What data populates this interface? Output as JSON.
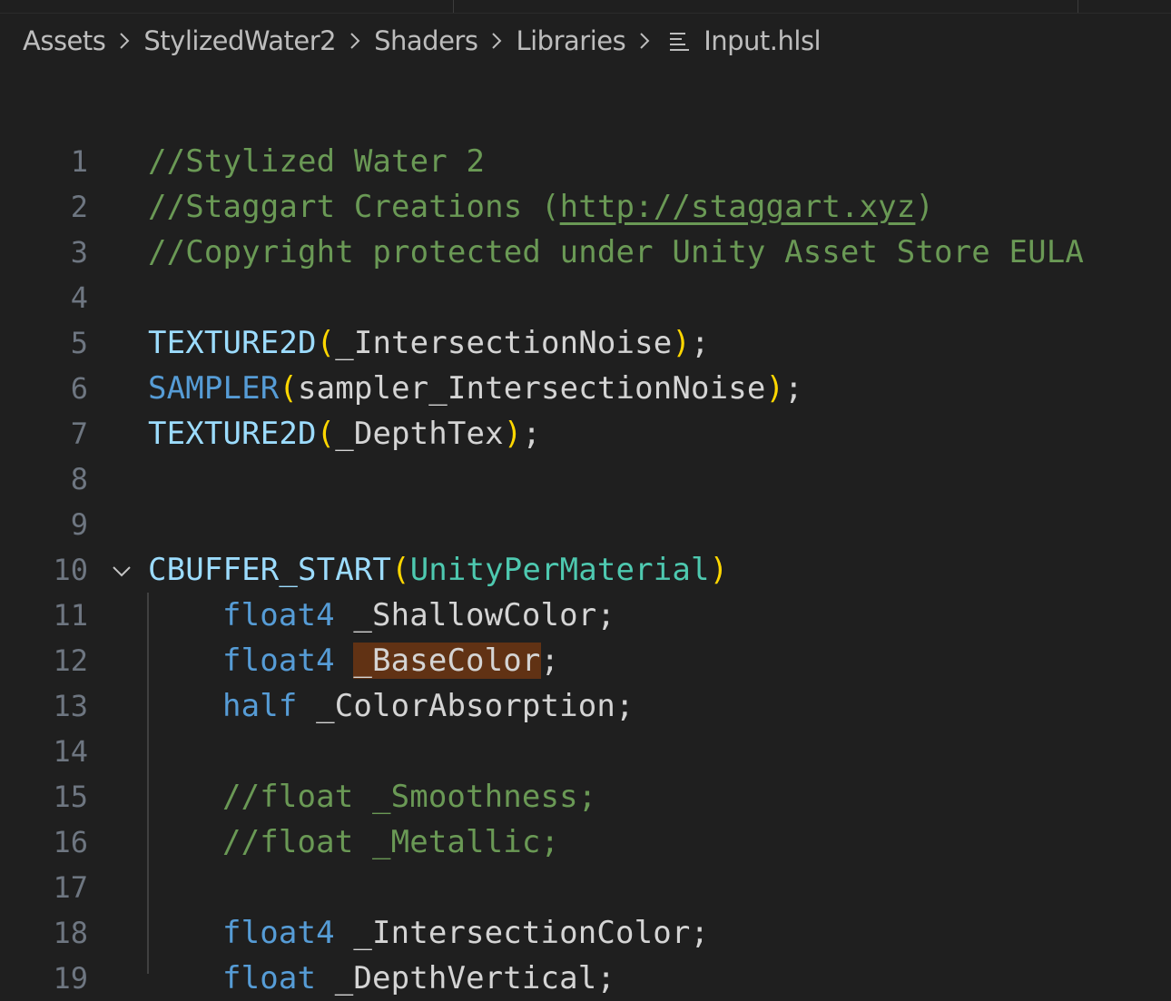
{
  "breadcrumb": {
    "items": [
      "Assets",
      "StylizedWater2",
      "Shaders",
      "Libraries"
    ],
    "file": "Input.hlsl"
  },
  "line_numbers": [
    "1",
    "2",
    "3",
    "4",
    "5",
    "6",
    "7",
    "8",
    "9",
    "10",
    "11",
    "12",
    "13",
    "14",
    "15",
    "16",
    "17",
    "18",
    "19"
  ],
  "code": {
    "l1": "//Stylized Water 2",
    "l2_a": "//Staggart Creations (",
    "l2_link": "http://staggart.xyz",
    "l2_b": ")",
    "l3": "//Copyright protected under Unity Asset Store EULA",
    "l5_macro": "TEXTURE2D",
    "l5_open": "(",
    "l5_arg": "_IntersectionNoise",
    "l5_close": ")",
    "l5_end": ";",
    "l6_macro": "SAMPLER",
    "l6_open": "(",
    "l6_arg": "sampler_IntersectionNoise",
    "l6_close": ")",
    "l6_end": ";",
    "l7_macro": "TEXTURE2D",
    "l7_open": "(",
    "l7_arg": "_DepthTex",
    "l7_close": ")",
    "l7_end": ";",
    "l10_macro": "CBUFFER_START",
    "l10_open": "(",
    "l10_arg": "UnityPerMaterial",
    "l10_close": ")",
    "l11_type": "float4",
    "l11_name": " _ShallowColor;",
    "l12_type": "float4",
    "l12_sp": " ",
    "l12_name": "_BaseColor",
    "l12_end": ";",
    "l13_type": "half",
    "l13_name": " _ColorAbsorption;",
    "l15": "//float _Smoothness;",
    "l16": "//float _Metallic;",
    "l18_type": "float4",
    "l18_name": " _IntersectionColor;",
    "l19_type": "float",
    "l19_name": " _DepthVertical;"
  },
  "colors": {
    "background": "#1f1f1f",
    "comment": "#6a9955",
    "keyword": "#569cd6",
    "macro": "#9cdcfe",
    "bracket": "#ffd700",
    "highlight": "#613214",
    "line_number": "#6e7681"
  },
  "icons": {
    "breadcrumb_separator": "chevron-right-icon",
    "file": "file-lines-icon",
    "fold": "chevron-down-icon"
  }
}
